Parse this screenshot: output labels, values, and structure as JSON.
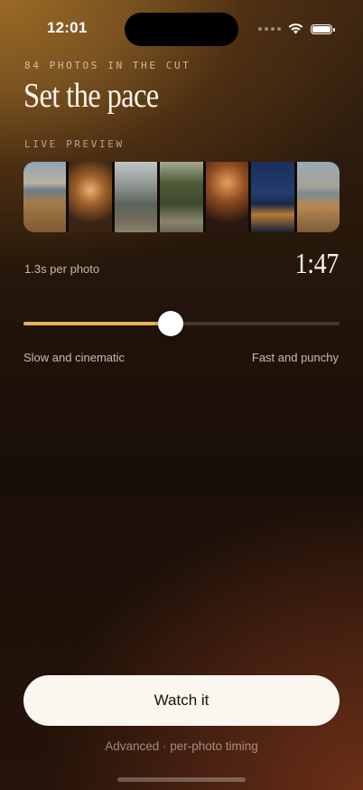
{
  "status_bar": {
    "time": "12:01"
  },
  "header": {
    "eyebrow": "84 PHOTOS IN THE CUT",
    "title": "Set the pace"
  },
  "preview": {
    "label": "LIVE PREVIEW"
  },
  "pace": {
    "per_photo": "1.3s per photo",
    "total_duration": "1:47",
    "slider_level": 0.465,
    "min_label": "Slow and cinematic",
    "max_label": "Fast and punchy",
    "accent_color": "#e6b160"
  },
  "actions": {
    "primary_label": "Watch it",
    "secondary_label": "Advanced · per-photo timing"
  }
}
